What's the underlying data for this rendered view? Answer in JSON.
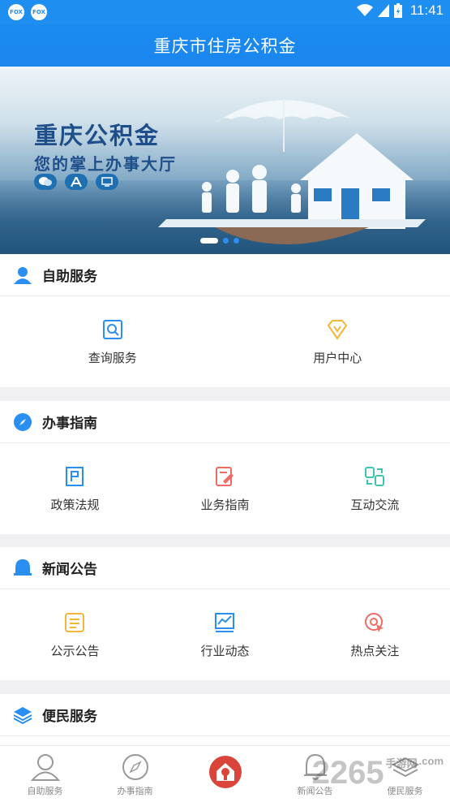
{
  "status_bar": {
    "app_icons": [
      "FOX",
      "FOX"
    ],
    "time": "11:41"
  },
  "header": {
    "title": "重庆市住房公积金"
  },
  "banner": {
    "title": "重庆公积金",
    "subtitle": "您的掌上办事大厅",
    "platform_icons": [
      "wechat-icon",
      "app-store-icon",
      "desktop-icon"
    ],
    "slide_count": 3,
    "active_slide": 1
  },
  "sections": [
    {
      "title": "自助服务",
      "icon": "person-icon",
      "items": [
        {
          "label": "查询服务",
          "icon": "search-doc-icon",
          "color": "#2a8ff0"
        },
        {
          "label": "用户中心",
          "icon": "diamond-icon",
          "color": "#f2b63a"
        }
      ]
    },
    {
      "title": "办事指南",
      "icon": "compass-icon",
      "items": [
        {
          "label": "政策法规",
          "icon": "flag-doc-icon",
          "color": "#2a8ff0"
        },
        {
          "label": "业务指南",
          "icon": "edit-doc-icon",
          "color": "#f06a64"
        },
        {
          "label": "互动交流",
          "icon": "exchange-icon",
          "color": "#3ec4b0"
        }
      ]
    },
    {
      "title": "新闻公告",
      "icon": "bell-icon",
      "items": [
        {
          "label": "公示公告",
          "icon": "notice-icon",
          "color": "#f2b63a"
        },
        {
          "label": "行业动态",
          "icon": "trend-icon",
          "color": "#2a8ff0"
        },
        {
          "label": "热点关注",
          "icon": "target-icon",
          "color": "#f06a64"
        }
      ]
    },
    {
      "title": "便民服务",
      "icon": "layers-icon",
      "items": []
    }
  ],
  "tab_bar": [
    {
      "label": "自助服务",
      "icon": "person-outline-icon"
    },
    {
      "label": "办事指南",
      "icon": "compass-outline-icon"
    },
    {
      "label": "",
      "icon": "home-lock-icon"
    },
    {
      "label": "新闻公告",
      "icon": "bell-outline-icon"
    },
    {
      "label": "便民服务",
      "icon": "layers-outline-icon"
    }
  ],
  "watermark": {
    "text": "2265",
    "suffix": "手游网",
    "domain": ".com"
  },
  "colors": {
    "primary": "#1e8ef1",
    "accent_red": "#d9453b"
  }
}
